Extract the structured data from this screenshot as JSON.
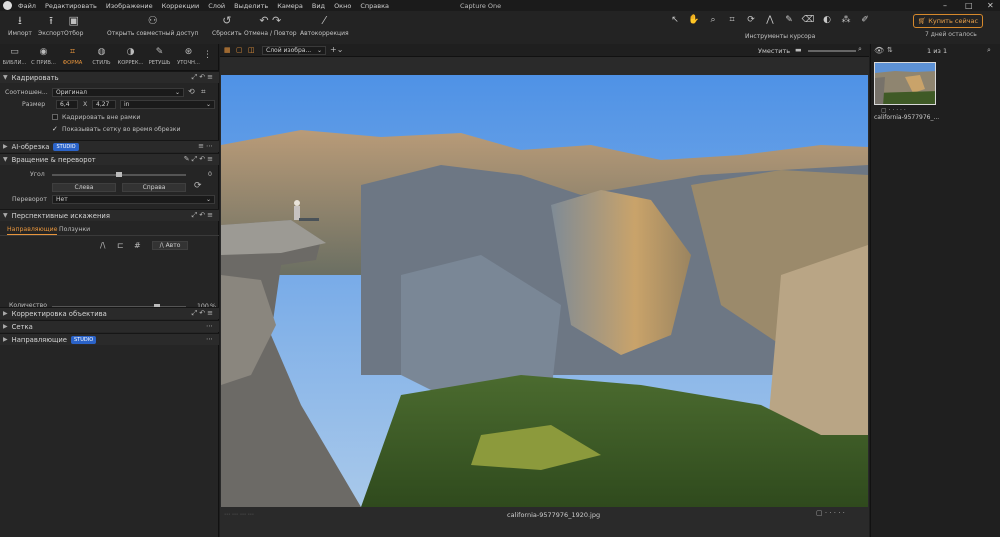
{
  "app": {
    "title": "Capture One"
  },
  "menu": [
    "Файл",
    "Редактировать",
    "Изображение",
    "Коррекции",
    "Слой",
    "Выделить",
    "Камера",
    "Вид",
    "Окно",
    "Справка"
  ],
  "toolbar": {
    "import": "Импорт",
    "export": "Экспорт",
    "select": "Отбор",
    "share": "Открыть совместный доступ",
    "reset": "Сбросить",
    "undo_redo": "Отмена / Повтор",
    "autocorrect": "Автокоррекция",
    "cursor_tools": "Инструменты курсора",
    "buy": "Купить сейчас",
    "trial": "7 дней осталось"
  },
  "tabs": [
    {
      "label": "БИБЛИ...",
      "icon": "folder-icon"
    },
    {
      "label": "С ПРИВ...",
      "icon": "camera-icon"
    },
    {
      "label": "ФОРМА",
      "icon": "crop-icon",
      "active": true
    },
    {
      "label": "СТИЛЬ",
      "icon": "palette-icon"
    },
    {
      "label": "КОРРЕК...",
      "icon": "exposure-icon"
    },
    {
      "label": "РЕТУШЬ",
      "icon": "brush-icon"
    },
    {
      "label": "УТОЧН...",
      "icon": "details-icon"
    }
  ],
  "crop": {
    "title": "Кадрировать",
    "ratio_label": "Соотношен...",
    "ratio_value": "Оригинал",
    "size_label": "Размер",
    "width": "6,4",
    "x": "X",
    "height": "4,27",
    "unit": "in",
    "outside_label": "Кадрировать вне рамки",
    "grid_label": "Показывать сетку во время обрезки"
  },
  "ai_crop": {
    "title": "AI-обрезка",
    "badge": "STUDIO"
  },
  "rotation": {
    "title": "Вращение & переворот",
    "angle_label": "Угол",
    "angle_value": "0",
    "left": "Слева",
    "right": "Справа",
    "flip_label": "Переворот",
    "flip_value": "Нет"
  },
  "perspective": {
    "title": "Перспективные искажения",
    "tab1": "Направляющие",
    "tab2": "Ползунки",
    "auto": "Авто",
    "amount_label": "Количество",
    "amount_value": "100",
    "amount_unit": "%",
    "amount_level": 1.0
  },
  "lens": {
    "title": "Корректировка объектива"
  },
  "grid": {
    "title": "Сетка"
  },
  "guides": {
    "title": "Направляющие",
    "badge": "STUDIO"
  },
  "viewbar": {
    "layer": "Слой изобра...",
    "fit": "Уместить",
    "counter": "1 из 1"
  },
  "viewer": {
    "filename": "california-9577976_1920.jpg"
  },
  "browser": {
    "thumb_name": "california-9577976_..."
  }
}
